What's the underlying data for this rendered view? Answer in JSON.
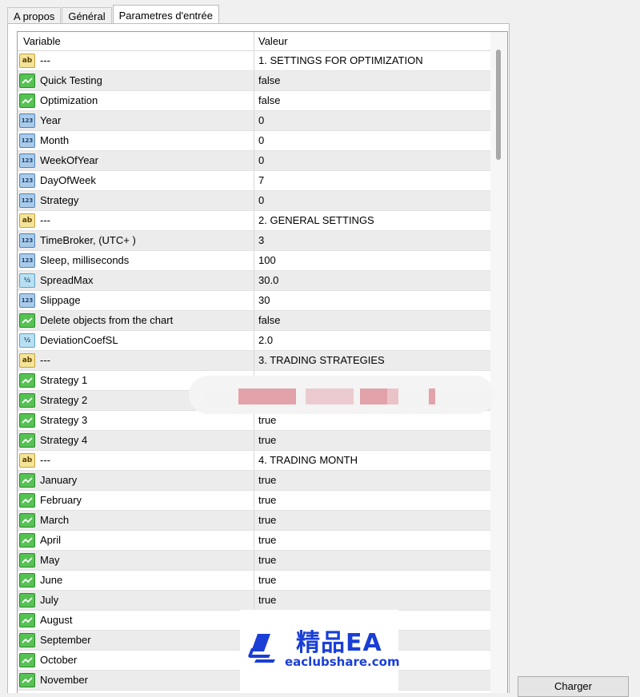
{
  "tabs": [
    {
      "label": "A propos",
      "active": false
    },
    {
      "label": "Général",
      "active": false
    },
    {
      "label": "Parametres d'entrée",
      "active": true
    }
  ],
  "columns": {
    "variable": "Variable",
    "value": "Valeur"
  },
  "rows": [
    {
      "type": "ab",
      "name": "---",
      "value": "1. SETTINGS FOR OPTIMIZATION"
    },
    {
      "type": "bool",
      "name": "Quick Testing",
      "value": "false"
    },
    {
      "type": "bool",
      "name": "Optimization",
      "value": "false"
    },
    {
      "type": "num",
      "name": "Year",
      "value": "0"
    },
    {
      "type": "num",
      "name": "Month",
      "value": "0"
    },
    {
      "type": "num",
      "name": "WeekOfYear",
      "value": "0"
    },
    {
      "type": "num",
      "name": "DayOfWeek",
      "value": "7"
    },
    {
      "type": "num",
      "name": "Strategy",
      "value": "0"
    },
    {
      "type": "ab",
      "name": "---",
      "value": "2. GENERAL SETTINGS"
    },
    {
      "type": "num",
      "name": "TimeBroker, (UTC+ )",
      "value": "3"
    },
    {
      "type": "num",
      "name": "Sleep, milliseconds",
      "value": "100"
    },
    {
      "type": "frac",
      "name": "SpreadMax",
      "value": "30.0"
    },
    {
      "type": "num",
      "name": "Slippage",
      "value": "30"
    },
    {
      "type": "bool",
      "name": "Delete objects from the chart",
      "value": "false"
    },
    {
      "type": "frac",
      "name": "DeviationCoefSL",
      "value": "2.0"
    },
    {
      "type": "ab",
      "name": "---",
      "value": "3. TRADING STRATEGIES"
    },
    {
      "type": "bool",
      "name": "Strategy 1",
      "value": ""
    },
    {
      "type": "bool",
      "name": "Strategy 2",
      "value": ""
    },
    {
      "type": "bool",
      "name": "Strategy 3",
      "value": "true"
    },
    {
      "type": "bool",
      "name": "Strategy 4",
      "value": "true"
    },
    {
      "type": "ab",
      "name": "---",
      "value": "4. TRADING MONTH"
    },
    {
      "type": "bool",
      "name": "January",
      "value": "true"
    },
    {
      "type": "bool",
      "name": "February",
      "value": "true"
    },
    {
      "type": "bool",
      "name": "March",
      "value": "true"
    },
    {
      "type": "bool",
      "name": "April",
      "value": "true"
    },
    {
      "type": "bool",
      "name": "May",
      "value": "true"
    },
    {
      "type": "bool",
      "name": "June",
      "value": "true"
    },
    {
      "type": "bool",
      "name": "July",
      "value": "true"
    },
    {
      "type": "bool",
      "name": "August",
      "value": ""
    },
    {
      "type": "bool",
      "name": "September",
      "value": ""
    },
    {
      "type": "bool",
      "name": "October",
      "value": ""
    },
    {
      "type": "bool",
      "name": "November",
      "value": ""
    }
  ],
  "icon_labels": {
    "ab": "ab",
    "num": "123",
    "frac": "½"
  },
  "watermark": {
    "title": "精品EA",
    "subtitle": "eaclubshare.com"
  },
  "load_button": "Charger",
  "colors": {
    "watermark": "#1a3fd6",
    "bool_icon": "#56c254",
    "num_icon": "#a9cbe9",
    "ab_icon": "#f3e49a"
  }
}
